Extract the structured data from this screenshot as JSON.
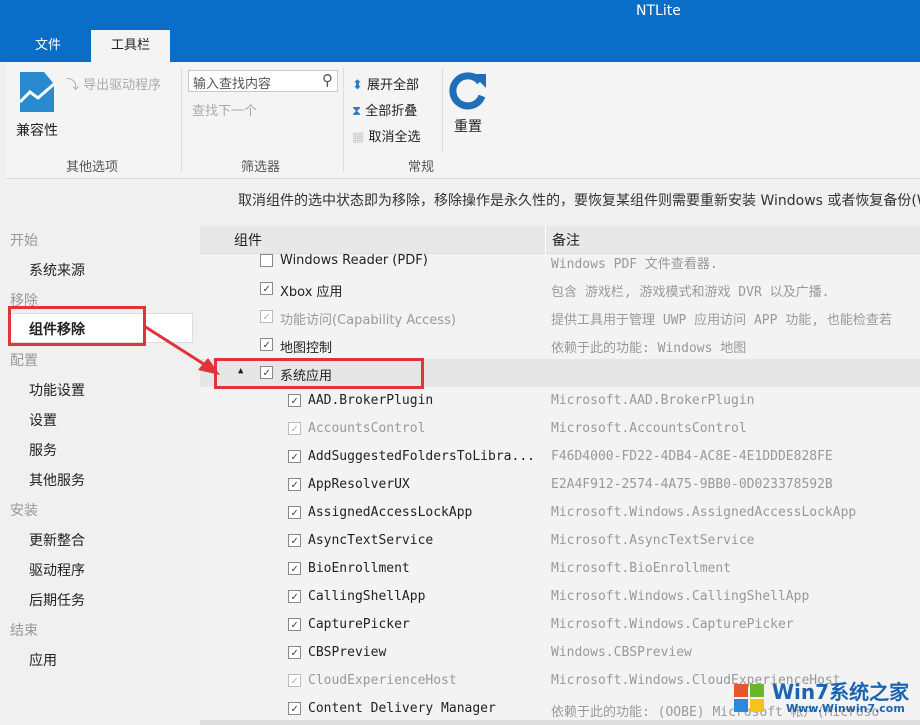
{
  "window": {
    "title": "NTLite"
  },
  "tabs": [
    {
      "label": "文件"
    },
    {
      "label": "工具栏"
    }
  ],
  "ribbon": {
    "compat": "兼容性",
    "export_drivers": "导出驱动程序",
    "group_other": "其他选项",
    "search_placeholder": "输入查找内容",
    "find_next": "查找下一个",
    "group_filter": "筛选器",
    "expand_all": "展开全部",
    "collapse_all": "全部折叠",
    "deselect_all": "取消全选",
    "reset": "重置",
    "group_general": "常规"
  },
  "info": "取消组件的选中状态即为移除，移除操作是永久性的，要恢复某组件则需要重新安装 Windows 或者恢复备份(W",
  "sidebar": {
    "sections": [
      {
        "label": "开始",
        "items": [
          "系统来源"
        ]
      },
      {
        "label": "移除",
        "items": [
          "组件移除"
        ]
      },
      {
        "label": "配置",
        "items": [
          "功能设置",
          "设置",
          "服务",
          "其他服务"
        ]
      },
      {
        "label": "安装",
        "items": [
          "更新整合",
          "驱动程序",
          "后期任务"
        ]
      },
      {
        "label": "结束",
        "items": [
          "应用"
        ]
      }
    ]
  },
  "list": {
    "columns": [
      "组件",
      "备注"
    ],
    "rows": [
      {
        "name": "Windows Reader (PDF)",
        "note": "Windows PDF 文件查看器.",
        "checked": false,
        "level": 1
      },
      {
        "name": "Xbox 应用",
        "note": "包含 游戏栏, 游戏模式和游戏 DVR 以及广播.",
        "checked": true,
        "level": 1
      },
      {
        "name": "功能访问(Capability Access)",
        "note": "提供工具用于管理 UWP 应用访问 APP 功能, 也能检查若",
        "checked": true,
        "level": 1,
        "disabled": true
      },
      {
        "name": "地图控制",
        "note": "依赖于此的功能: Windows 地图",
        "checked": true,
        "level": 1
      },
      {
        "name": "系统应用",
        "note": "",
        "checked": true,
        "level": 1,
        "expander": "▲",
        "highlight": true
      },
      {
        "name": "AAD.BrokerPlugin",
        "note": "Microsoft.AAD.BrokerPlugin",
        "checked": true,
        "level": 2
      },
      {
        "name": "AccountsControl",
        "note": "Microsoft.AccountsControl",
        "checked": true,
        "level": 2,
        "disabled": true
      },
      {
        "name": "AddSuggestedFoldersToLibra...",
        "note": "F46D4000-FD22-4DB4-AC8E-4E1DDDE828FE",
        "checked": true,
        "level": 2
      },
      {
        "name": "AppResolverUX",
        "note": "E2A4F912-2574-4A75-9BB0-0D023378592B",
        "checked": true,
        "level": 2
      },
      {
        "name": "AssignedAccessLockApp",
        "note": "Microsoft.Windows.AssignedAccessLockApp",
        "checked": true,
        "level": 2
      },
      {
        "name": "AsyncTextService",
        "note": "Microsoft.AsyncTextService",
        "checked": true,
        "level": 2
      },
      {
        "name": "BioEnrollment",
        "note": "Microsoft.BioEnrollment",
        "checked": true,
        "level": 2
      },
      {
        "name": "CallingShellApp",
        "note": "Microsoft.Windows.CallingShellApp",
        "checked": true,
        "level": 2
      },
      {
        "name": "CapturePicker",
        "note": "Microsoft.Windows.CapturePicker",
        "checked": true,
        "level": 2
      },
      {
        "name": "CBSPreview",
        "note": "Windows.CBSPreview",
        "checked": true,
        "level": 2
      },
      {
        "name": "CloudExperienceHost",
        "note": "Microsoft.Windows.CloudExperienceHost",
        "checked": true,
        "level": 2,
        "disabled": true
      },
      {
        "name": "Content Delivery Manager",
        "note": "依赖于此的功能: (OOBE) Microsoft 帐户(Microso",
        "checked": true,
        "level": 2
      }
    ]
  },
  "watermark": {
    "brand": "Win7系统之家",
    "url": "Www.Winwin7.com"
  },
  "colors": {
    "titlebar": "#0a6ec8",
    "annotation": "#e0333a"
  }
}
